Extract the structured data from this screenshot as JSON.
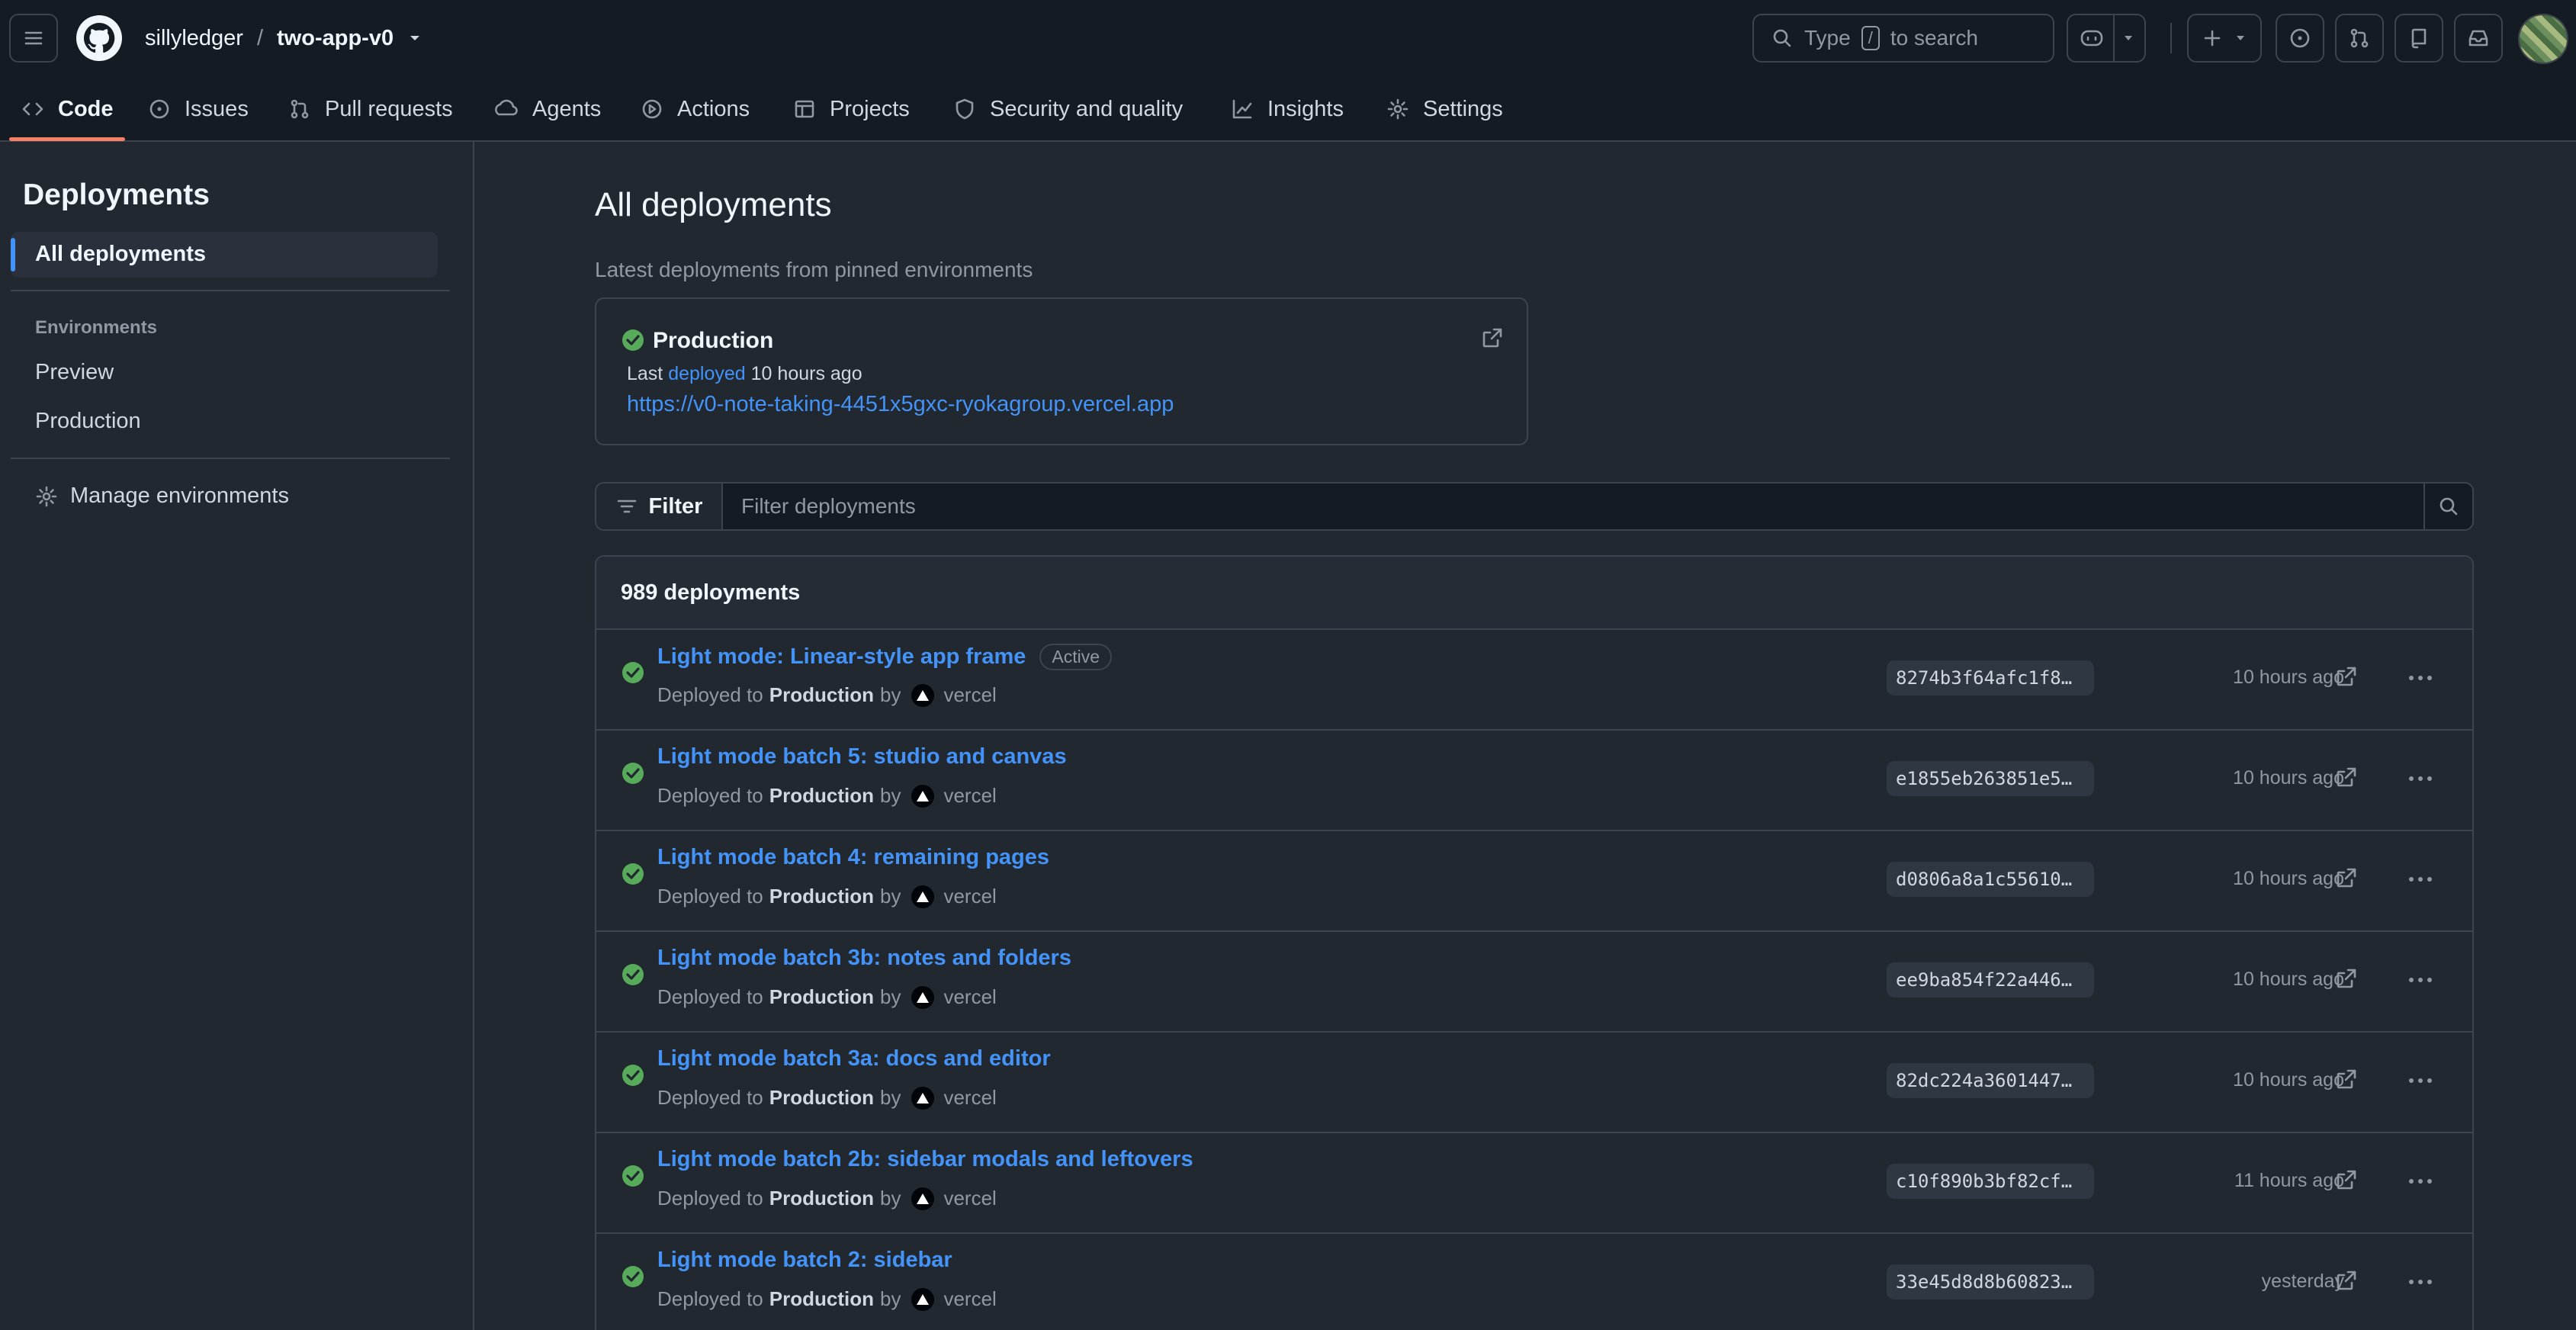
{
  "header": {
    "owner": "sillyledger",
    "separator": "/",
    "repo": "two-app-v0",
    "search": {
      "prefix": "Type",
      "key": "/",
      "suffix": "to search"
    }
  },
  "tabs": [
    {
      "label": "Code",
      "icon": "code-icon",
      "active": true
    },
    {
      "label": "Issues",
      "icon": "issue-opened-icon"
    },
    {
      "label": "Pull requests",
      "icon": "git-pull-request-icon"
    },
    {
      "label": "Agents",
      "icon": "agent-icon"
    },
    {
      "label": "Actions",
      "icon": "play-icon"
    },
    {
      "label": "Projects",
      "icon": "table-icon"
    },
    {
      "label": "Security and quality",
      "icon": "shield-icon"
    },
    {
      "label": "Insights",
      "icon": "graph-icon"
    },
    {
      "label": "Settings",
      "icon": "gear-icon"
    }
  ],
  "sidebar": {
    "title": "Deployments",
    "all_label": "All deployments",
    "group_label": "Environments",
    "environments": [
      "Preview",
      "Production"
    ],
    "manage_label": "Manage environments"
  },
  "main": {
    "title": "All deployments",
    "pinned_caption": "Latest deployments from pinned environments",
    "pinned": {
      "environment": "Production",
      "last_prefix": "Last",
      "last_link": "deployed",
      "last_suffix": "10 hours ago",
      "url": "https://v0-note-taking-4451x5gxc-ryokagroup.vercel.app"
    },
    "filter": {
      "button_label": "Filter",
      "placeholder": "Filter deployments"
    },
    "list": {
      "count_label": "989 deployments",
      "rows": [
        {
          "title": "Light mode: Linear-style app frame",
          "badge": "Active",
          "prefix": "Deployed to",
          "env": "Production",
          "by": "by",
          "actor": "vercel",
          "sha": "8274b3f64afc1f8…",
          "time": "10 hours ago"
        },
        {
          "title": "Light mode batch 5: studio and canvas",
          "badge": "",
          "prefix": "Deployed to",
          "env": "Production",
          "by": "by",
          "actor": "vercel",
          "sha": "e1855eb263851e5…",
          "time": "10 hours ago"
        },
        {
          "title": "Light mode batch 4: remaining pages",
          "badge": "",
          "prefix": "Deployed to",
          "env": "Production",
          "by": "by",
          "actor": "vercel",
          "sha": "d0806a8a1c55610…",
          "time": "10 hours ago"
        },
        {
          "title": "Light mode batch 3b: notes and folders",
          "badge": "",
          "prefix": "Deployed to",
          "env": "Production",
          "by": "by",
          "actor": "vercel",
          "sha": "ee9ba854f22a446…",
          "time": "10 hours ago"
        },
        {
          "title": "Light mode batch 3a: docs and editor",
          "badge": "",
          "prefix": "Deployed to",
          "env": "Production",
          "by": "by",
          "actor": "vercel",
          "sha": "82dc224a3601447…",
          "time": "10 hours ago"
        },
        {
          "title": "Light mode batch 2b: sidebar modals and leftovers",
          "badge": "",
          "prefix": "Deployed to",
          "env": "Production",
          "by": "by",
          "actor": "vercel",
          "sha": "c10f890b3bf82cf…",
          "time": "11 hours ago"
        },
        {
          "title": "Light mode batch 2: sidebar",
          "badge": "",
          "prefix": "Deployed to",
          "env": "Production",
          "by": "by",
          "actor": "vercel",
          "sha": "33e45d8d8b60823…",
          "time": "yesterday"
        }
      ]
    }
  },
  "colors": {
    "background": "#212830",
    "header": "#151b23",
    "link": "#4493f8",
    "success": "#57ab5a",
    "tab_underline": "#f78166"
  }
}
